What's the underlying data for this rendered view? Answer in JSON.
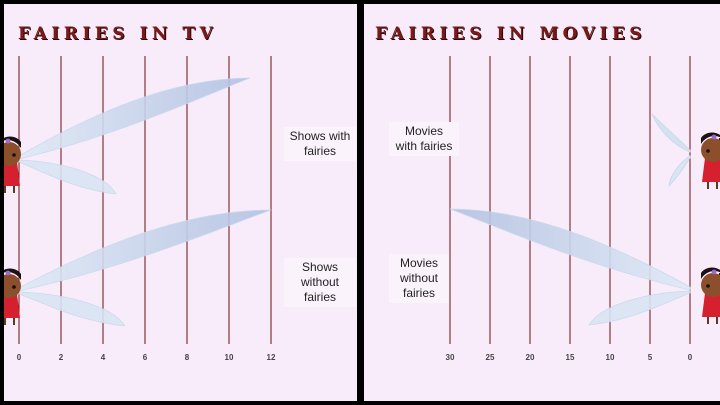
{
  "chart_data": [
    {
      "type": "bar",
      "orientation": "horizontal",
      "title": "Fairies in TV",
      "categories": [
        "Shows with fairies",
        "Shows without fairies"
      ],
      "values": [
        11,
        12
      ],
      "xlim": [
        0,
        12
      ],
      "xticks": [
        0,
        2,
        4,
        6,
        8,
        10,
        12
      ],
      "grid": true,
      "bars_drawn_as": "fairy wings",
      "colors": {
        "gridline": "#6b1111",
        "title": "#7a1a1a",
        "wing": "#bcd3ea",
        "wing_shadow": "#9fb0df"
      }
    },
    {
      "type": "bar",
      "orientation": "horizontal",
      "title": "Fairies in Movies",
      "categories": [
        "Movies with fairies",
        "Movies without fairies"
      ],
      "values": [
        1,
        30
      ],
      "xlim": [
        0,
        30
      ],
      "x_reversed": true,
      "xticks": [
        30,
        25,
        20,
        15,
        10,
        5,
        0
      ],
      "grid": true,
      "bars_drawn_as": "fairy wings",
      "colors": {
        "gridline": "#6b1111",
        "title": "#7a1a1a",
        "wing": "#bcd3ea",
        "wing_shadow": "#9fb0df"
      }
    }
  ]
}
